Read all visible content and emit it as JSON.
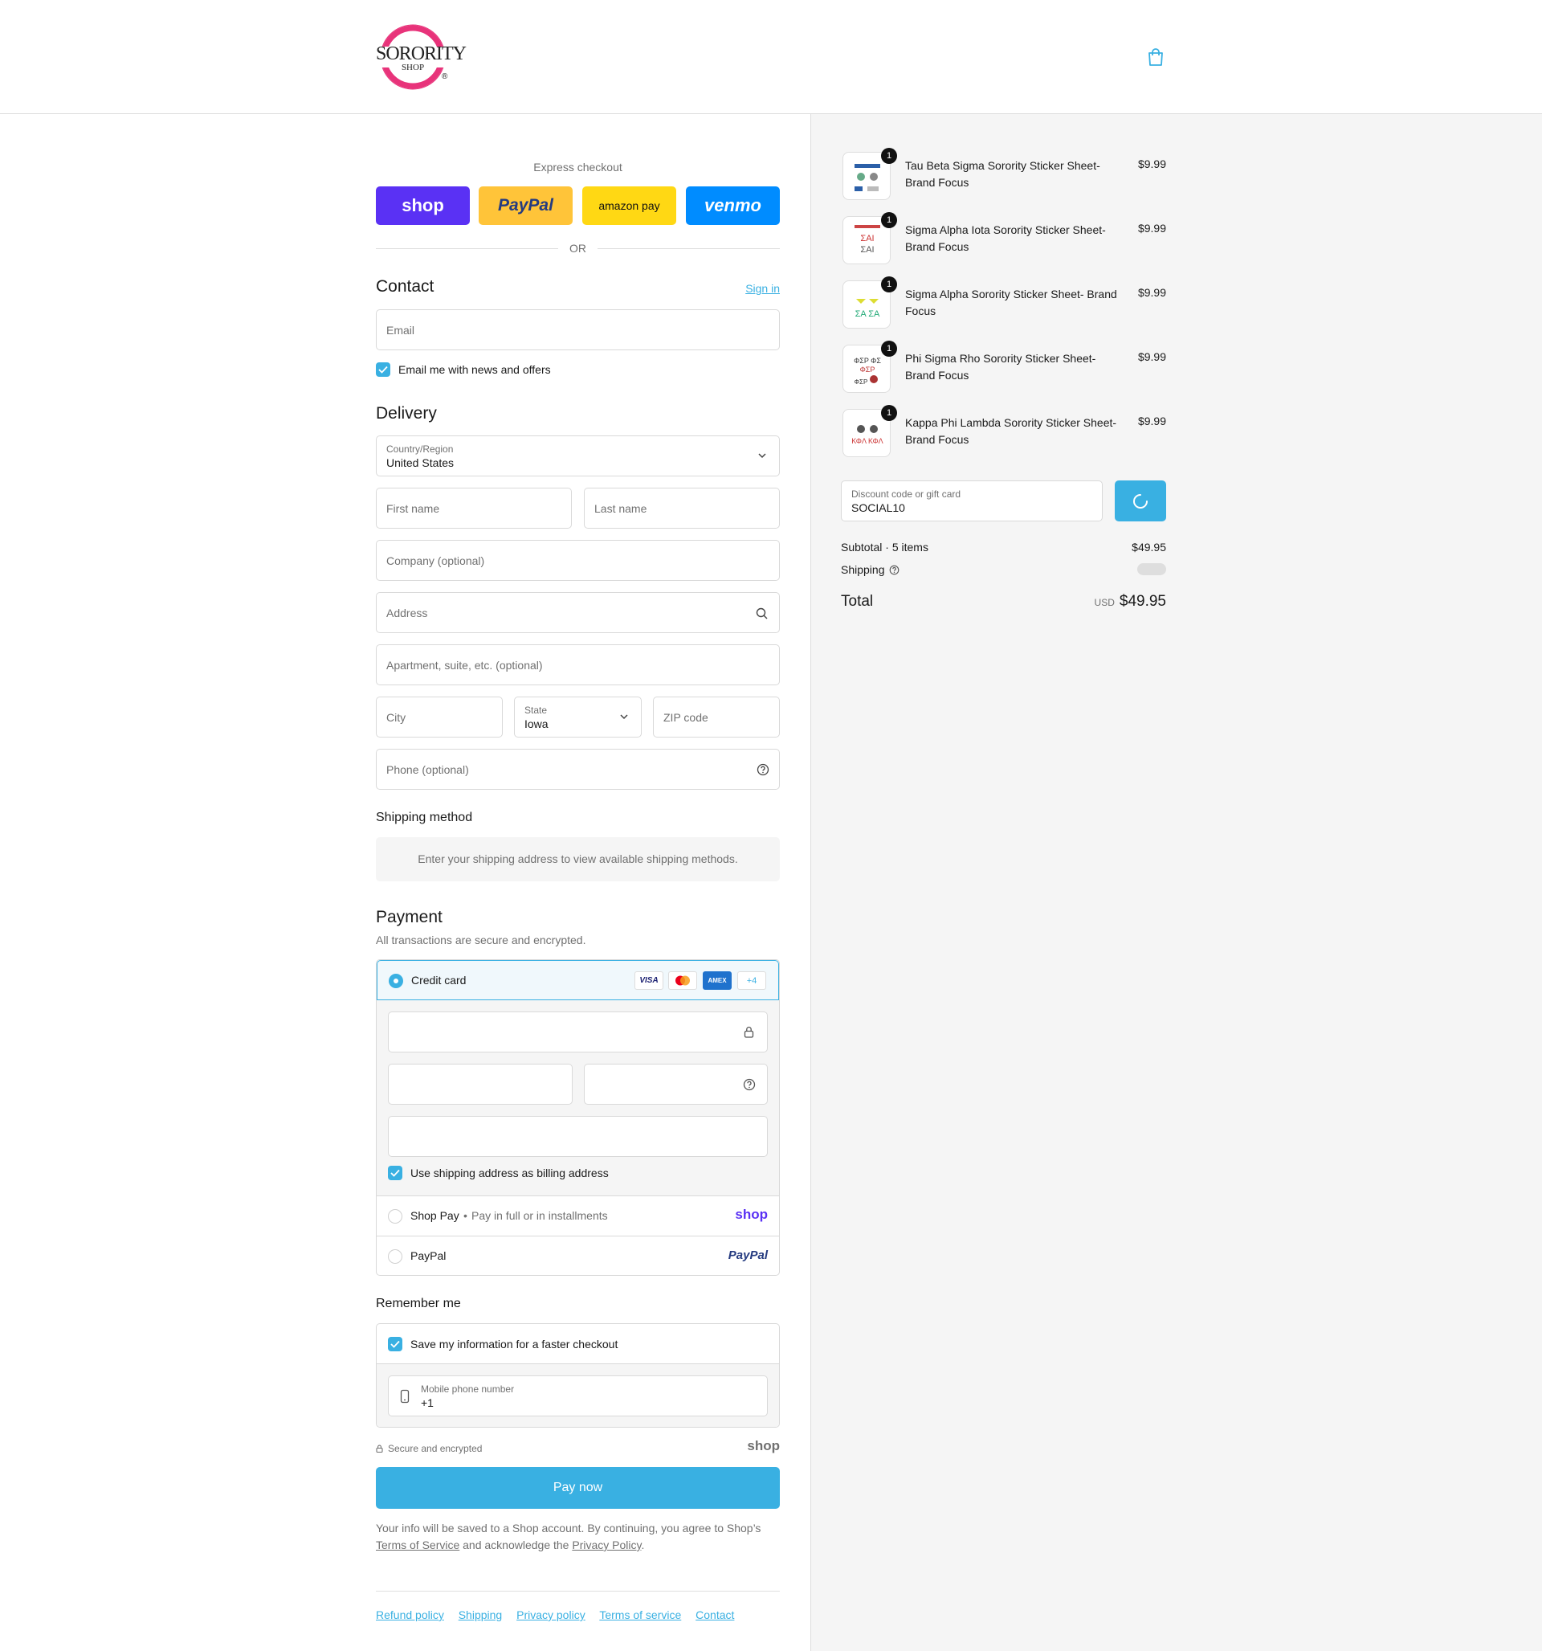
{
  "header": {
    "logo_text_top": "SORORITY",
    "logo_text_bottom": "SHOP",
    "logo_mark": "®",
    "cart_icon": "shopping-bag-icon"
  },
  "express": {
    "title": "Express checkout",
    "buttons": [
      {
        "label": "shop",
        "color": "#5a31f4"
      },
      {
        "label": "PayPal",
        "color": "#ffc439"
      },
      {
        "label": "amazon pay",
        "color": "#ffd814"
      },
      {
        "label": "venmo",
        "color": "#008cff"
      }
    ],
    "or_text": "OR"
  },
  "contact": {
    "title": "Contact",
    "sign_in": "Sign in",
    "email_placeholder": "Email",
    "newsletter_label": "Email me with news and offers"
  },
  "delivery": {
    "title": "Delivery",
    "country_label": "Country/Region",
    "country_value": "United States",
    "first_name": "First name",
    "last_name": "Last name",
    "company": "Company (optional)",
    "address": "Address",
    "apartment": "Apartment, suite, etc. (optional)",
    "city": "City",
    "state_label": "State",
    "state_value": "Iowa",
    "zip": "ZIP code",
    "phone": "Phone (optional)"
  },
  "shipping_method": {
    "title": "Shipping method",
    "message": "Enter your shipping address to view available shipping methods."
  },
  "payment": {
    "title": "Payment",
    "subtitle": "All transactions are secure and encrypted.",
    "credit_card_label": "Credit card",
    "card_brands": [
      "VISA",
      "mastercard",
      "AMEX",
      "+4"
    ],
    "billing_label": "Use shipping address as billing address",
    "shop_pay_label": "Shop Pay",
    "shop_pay_sub": "Pay in full or in installments",
    "shop_logo": "shop",
    "paypal_label": "PayPal",
    "paypal_logo": "PayPal"
  },
  "remember": {
    "title": "Remember me",
    "save_label": "Save my information for a faster checkout",
    "phone_label": "Mobile phone number",
    "phone_value": "+1",
    "secure_text": "Secure and encrypted",
    "shop_logo": "shop"
  },
  "pay_button": "Pay now",
  "legal": {
    "text1": "Your info will be saved to a Shop account. By continuing, you agree to Shop’s",
    "tos": "Terms of Service",
    "text2": "and acknowledge the",
    "privacy": "Privacy Policy",
    "end": "."
  },
  "footer_links": [
    "Refund policy",
    "Shipping",
    "Privacy policy",
    "Terms of service",
    "Contact"
  ],
  "summary": {
    "items": [
      {
        "name": "Tau Beta Sigma Sorority Sticker Sheet- Brand Focus",
        "price": "$9.99",
        "qty": "1"
      },
      {
        "name": "Sigma Alpha Iota Sorority Sticker Sheet- Brand Focus",
        "price": "$9.99",
        "qty": "1"
      },
      {
        "name": "Sigma Alpha Sorority Sticker Sheet- Brand Focus",
        "price": "$9.99",
        "qty": "1"
      },
      {
        "name": "Phi Sigma Rho Sorority Sticker Sheet- Brand Focus",
        "price": "$9.99",
        "qty": "1"
      },
      {
        "name": "Kappa Phi Lambda Sorority Sticker Sheet- Brand Focus",
        "price": "$9.99",
        "qty": "1"
      }
    ],
    "discount_label": "Discount code or gift card",
    "discount_value": "SOCIAL10",
    "subtotal_label": "Subtotal · 5 items",
    "subtotal_value": "$49.95",
    "shipping_label": "Shipping",
    "total_label": "Total",
    "currency": "USD",
    "total_value": "$49.95"
  },
  "colors": {
    "accent": "#39b0e2",
    "border": "#d9d9d9",
    "logo_pink": "#e8337a"
  }
}
